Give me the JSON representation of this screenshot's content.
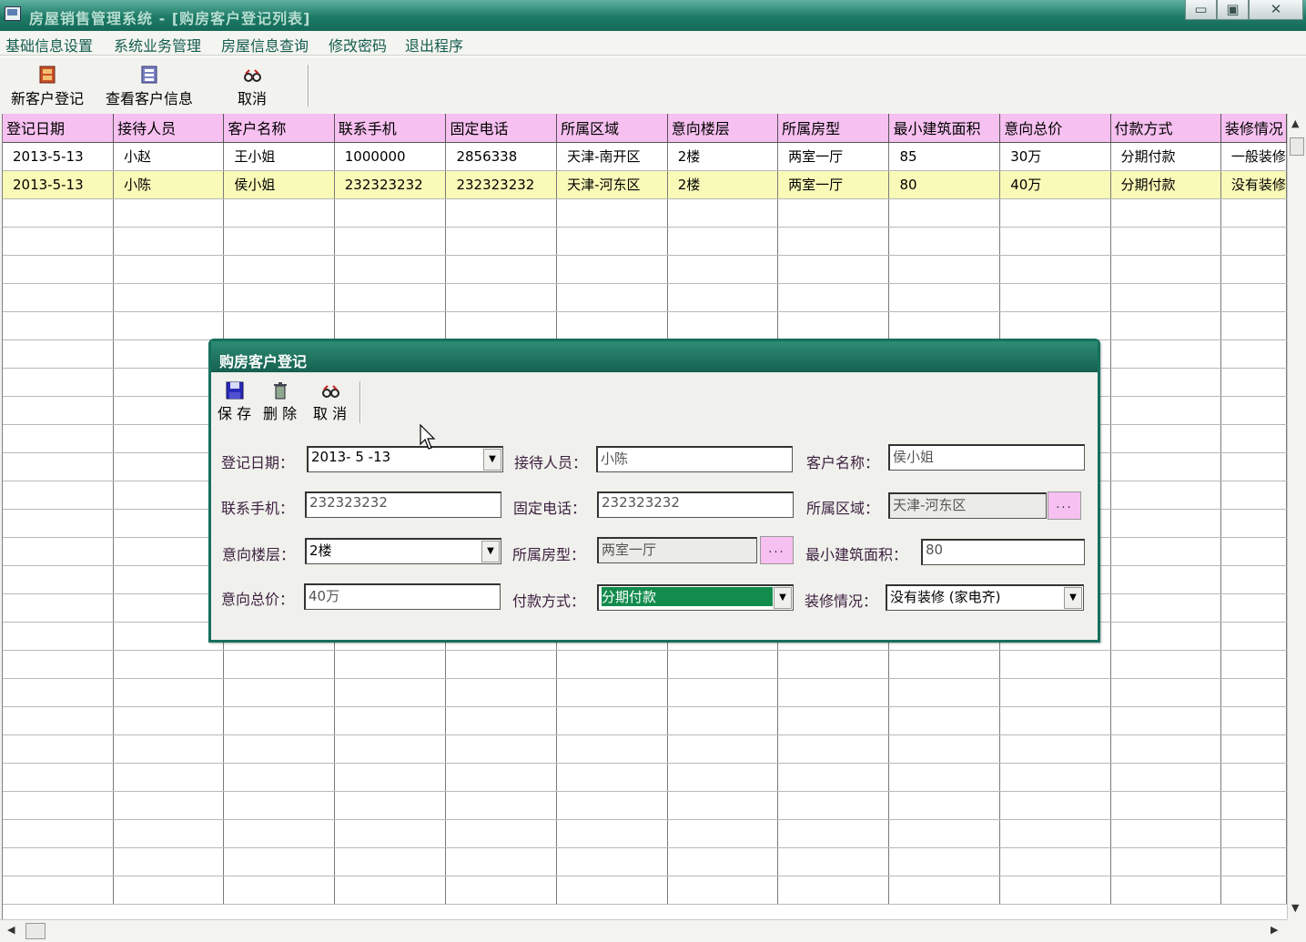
{
  "window": {
    "title": "房屋销售管理系统 - [购房客户登记列表]",
    "min_symbol": "▭",
    "max_symbol": "▣",
    "close_symbol": "✕"
  },
  "menu": [
    "基础信息设置",
    "系统业务管理",
    "房屋信息查询",
    "修改密码",
    "退出程序"
  ],
  "toolbar": {
    "new_customer": "新客户登记",
    "view_customers": "查看客户信息",
    "cancel": "取消"
  },
  "grid": {
    "columns": [
      "登记日期",
      "接待人员",
      "客户名称",
      "联系手机",
      "固定电话",
      "所属区域",
      "意向楼层",
      "所属房型",
      "最小建筑面积",
      "意向总价",
      "付款方式",
      "装修情况"
    ],
    "rows": [
      [
        "2013-5-13",
        "小赵",
        "王小姐",
        "1000000",
        "2856338",
        "天津-南开区",
        "2楼",
        "两室一厅",
        "85",
        "30万",
        "分期付款",
        "一般装修"
      ],
      [
        "2013-5-13",
        "小陈",
        "侯小姐",
        "232323232",
        "232323232",
        "天津-河东区",
        "2楼",
        "两室一厅",
        "80",
        "40万",
        "分期付款",
        "没有装修"
      ]
    ],
    "selected_row": 1
  },
  "dialog": {
    "title": "购房客户登记",
    "save": "保 存",
    "delete": "删 除",
    "cancel": "取 消",
    "labels": {
      "reg_date": "登记日期：",
      "receptionist": "接待人员：",
      "customer_name": "客户名称：",
      "mobile": "联系手机：",
      "phone": "固定电话：",
      "region": "所属区域：",
      "floor": "意向楼层：",
      "house_type": "所属房型：",
      "min_area": "最小建筑面积：",
      "total_price": "意向总价：",
      "payment": "付款方式：",
      "decoration": "装修情况："
    },
    "values": {
      "reg_date": "2013- 5 -13",
      "receptionist": "小陈",
      "customer_name": "侯小姐",
      "mobile": "232323232",
      "phone": "232323232",
      "region": "天津-河东区",
      "floor": "2楼",
      "house_type": "两室一厅",
      "min_area": "80",
      "total_price": "40万",
      "payment": "分期付款",
      "decoration": "没有装修 (家电齐)"
    },
    "ellipsis": "...",
    "dropdown_arrow": "▼"
  },
  "scroll": {
    "up": "▲",
    "down": "▼",
    "left": "◀",
    "right": "▶"
  },
  "colors": {
    "title_bar": "#1c7a66",
    "header_bg": "#f6c0f0",
    "selected_row": "#fafab8",
    "highlight": "#128c4c"
  }
}
